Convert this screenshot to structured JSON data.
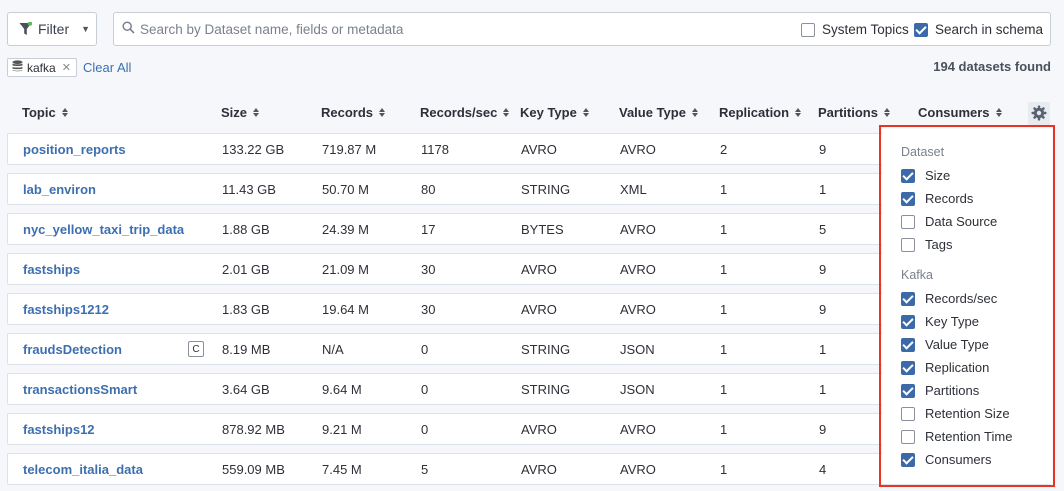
{
  "toolbar": {
    "filter_label": "Filter",
    "search_placeholder": "Search by Dataset name, fields or metadata",
    "search_value": "",
    "system_topics_label": "System Topics",
    "system_topics_checked": false,
    "search_in_schema_label": "Search in schema",
    "search_in_schema_checked": true
  },
  "active_filters": {
    "tag_label": "kafka",
    "clear_all_label": "Clear All",
    "results_count": "194 datasets found"
  },
  "table": {
    "columns": [
      "Topic",
      "Size",
      "Records",
      "Records/sec",
      "Key Type",
      "Value Type",
      "Replication",
      "Partitions",
      "Consumers"
    ],
    "rows": [
      {
        "topic": "position_reports",
        "size": "133.22 GB",
        "records": "719.87 M",
        "rps": "1178",
        "key": "AVRO",
        "value": "AVRO",
        "replication": "2",
        "partitions": "9",
        "badge": ""
      },
      {
        "topic": "lab_environ",
        "size": "11.43 GB",
        "records": "50.70 M",
        "rps": "80",
        "key": "STRING",
        "value": "XML",
        "replication": "1",
        "partitions": "1",
        "badge": ""
      },
      {
        "topic": "nyc_yellow_taxi_trip_data",
        "size": "1.88 GB",
        "records": "24.39 M",
        "rps": "17",
        "key": "BYTES",
        "value": "AVRO",
        "replication": "1",
        "partitions": "5",
        "badge": ""
      },
      {
        "topic": "fastships",
        "size": "2.01 GB",
        "records": "21.09 M",
        "rps": "30",
        "key": "AVRO",
        "value": "AVRO",
        "replication": "1",
        "partitions": "9",
        "badge": ""
      },
      {
        "topic": "fastships1212",
        "size": "1.83 GB",
        "records": "19.64 M",
        "rps": "30",
        "key": "AVRO",
        "value": "AVRO",
        "replication": "1",
        "partitions": "9",
        "badge": ""
      },
      {
        "topic": "fraudsDetection",
        "size": "8.19 MB",
        "records": "N/A",
        "rps": "0",
        "key": "STRING",
        "value": "JSON",
        "replication": "1",
        "partitions": "1",
        "badge": "C"
      },
      {
        "topic": "transactionsSmart",
        "size": "3.64 GB",
        "records": "9.64 M",
        "rps": "0",
        "key": "STRING",
        "value": "JSON",
        "replication": "1",
        "partitions": "1",
        "badge": ""
      },
      {
        "topic": "fastships12",
        "size": "878.92 MB",
        "records": "9.21 M",
        "rps": "0",
        "key": "AVRO",
        "value": "AVRO",
        "replication": "1",
        "partitions": "9",
        "badge": ""
      },
      {
        "topic": "telecom_italia_data",
        "size": "559.09 MB",
        "records": "7.45 M",
        "rps": "5",
        "key": "AVRO",
        "value": "AVRO",
        "replication": "1",
        "partitions": "4",
        "badge": ""
      }
    ]
  },
  "columns_panel": {
    "groups": [
      {
        "title": "Dataset",
        "options": [
          {
            "label": "Size",
            "checked": true
          },
          {
            "label": "Records",
            "checked": true
          },
          {
            "label": "Data Source",
            "checked": false
          },
          {
            "label": "Tags",
            "checked": false
          }
        ]
      },
      {
        "title": "Kafka",
        "options": [
          {
            "label": "Records/sec",
            "checked": true
          },
          {
            "label": "Key Type",
            "checked": true
          },
          {
            "label": "Value Type",
            "checked": true
          },
          {
            "label": "Replication",
            "checked": true
          },
          {
            "label": "Partitions",
            "checked": true
          },
          {
            "label": "Retention Size",
            "checked": false
          },
          {
            "label": "Retention Time",
            "checked": false
          },
          {
            "label": "Consumers",
            "checked": true
          }
        ]
      }
    ]
  },
  "colors": {
    "accent": "#3c6aa8",
    "link": "#3d6fb0",
    "highlight_border": "#e93323",
    "filter_dot": "#5cb85c"
  }
}
